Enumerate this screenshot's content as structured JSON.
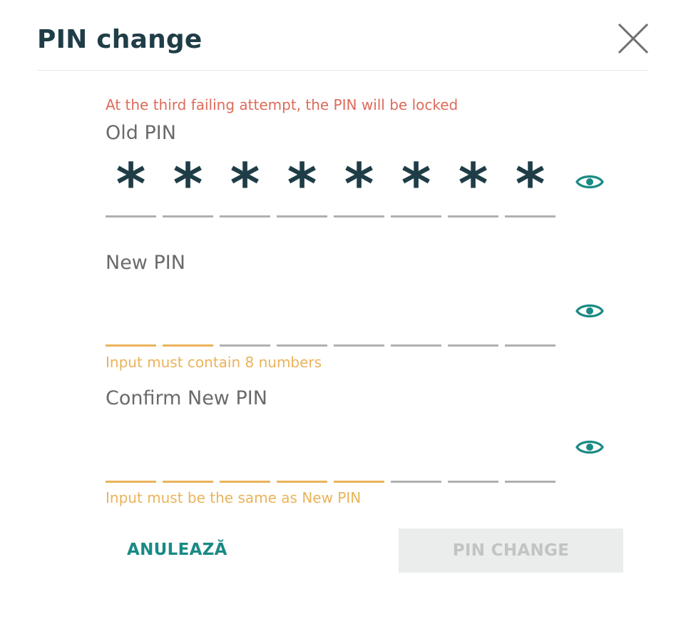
{
  "dialog": {
    "title": "PIN change",
    "warning": "At the third failing attempt, the PIN will be locked"
  },
  "colors": {
    "title": "#1f3d47",
    "warning": "#dd6b5a",
    "hint": "#eab35a",
    "accent": "#1a8a85",
    "underline_default": "#b0b0b0",
    "underline_filled": "#eab35a",
    "disabled_bg": "#ebeded",
    "disabled_text": "#c2c4c4"
  },
  "icons": {
    "close": "close-icon",
    "visibility": "eye-icon"
  },
  "old_pin": {
    "label": "Old PIN",
    "mask": [
      "*",
      "*",
      "*",
      "*",
      "*",
      "*",
      "*",
      "*"
    ],
    "filled_digits": 8
  },
  "new_pin": {
    "label": "New PIN",
    "hint": "Input must contain 8 numbers",
    "filled_digits": 2
  },
  "confirm_pin": {
    "label": "Confirm New PIN",
    "hint": "Input must be the same as New PIN",
    "filled_digits": 5
  },
  "actions": {
    "cancel": "ANULEAZĂ",
    "submit": "PIN CHANGE"
  }
}
